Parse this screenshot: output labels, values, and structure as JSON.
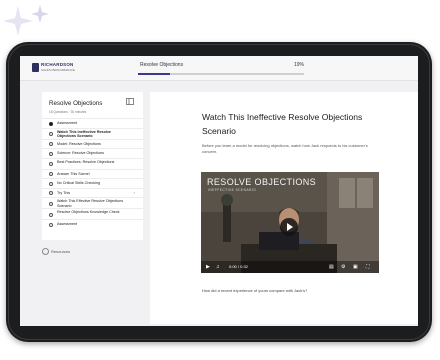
{
  "header": {
    "logo_name": "RICHARDSON",
    "logo_sub": "SALES PERFORMANCE",
    "breadcrumb": "Resolve Objections",
    "progress_percent": 19,
    "progress_label": "19%"
  },
  "sidebar": {
    "title": "Resolve Objections",
    "meta": "16 Questions · 30 minutes",
    "items": [
      {
        "label": "Assessment",
        "state": "complete"
      },
      {
        "label": "Watch This Ineffective Resolve Objections Scenario",
        "state": "current"
      },
      {
        "label": "Model: Resolve Objections",
        "state": "todo"
      },
      {
        "label": "Science: Resolve Objections",
        "state": "todo"
      },
      {
        "label": "Best Practices: Resolve Objections",
        "state": "todo"
      },
      {
        "label": "Answer This Scene!",
        "state": "todo"
      },
      {
        "label": "No Critical Skills Checking",
        "state": "todo"
      },
      {
        "label": "Try This",
        "state": "todo"
      },
      {
        "label": "Watch This Effective Resolve Objections Scenario",
        "state": "todo"
      },
      {
        "label": "Resolve Objections Knowledge Check",
        "state": "todo"
      },
      {
        "label": "Assessment",
        "state": "todo"
      }
    ],
    "resources_label": "Resources"
  },
  "lesson": {
    "title": "Watch This Ineffective Resolve Objections Scenario",
    "description": "Before you learn a model for resolving objections, watch how Jack responds to his customer's concern.",
    "video_title": "RESOLVE OBJECTIONS",
    "video_subtitle": "INEFFECTIVE SCENARIO",
    "video_time": "0:00 / 0:32",
    "question": "How did a recent experience of yours compare with Jack's?"
  },
  "colors": {
    "accent": "#3a3a90",
    "tablet_frame": "#1c1d1f",
    "screen_bg": "#f1f1f3"
  }
}
